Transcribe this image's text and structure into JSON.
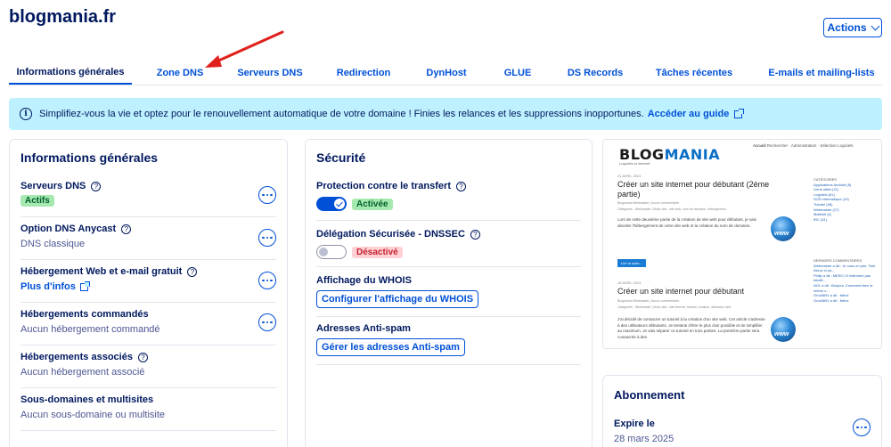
{
  "header": {
    "domain": "blogmania.fr",
    "actions_label": "Actions"
  },
  "tabs": [
    {
      "label": "Informations générales"
    },
    {
      "label": "Zone DNS"
    },
    {
      "label": "Serveurs DNS"
    },
    {
      "label": "Redirection"
    },
    {
      "label": "DynHost"
    },
    {
      "label": "GLUE"
    },
    {
      "label": "DS Records"
    },
    {
      "label": "Tâches récentes"
    },
    {
      "label": "E-mails et mailing-lists"
    }
  ],
  "banner": {
    "text": "Simplifiez-vous la vie et optez pour le renouvellement automatique de votre domaine ! Finies les relances et les suppressions inopportunes.",
    "link": "Accéder au guide"
  },
  "general_info": {
    "title": "Informations générales",
    "items": [
      {
        "label": "Serveurs DNS",
        "value": "Actifs"
      },
      {
        "label": "Option DNS Anycast",
        "value": "DNS classique"
      },
      {
        "label": "Hébergement Web et e-mail gratuit",
        "value": "Plus d'infos"
      },
      {
        "label": "Hébergements commandés",
        "value": "Aucun hébergement commandé"
      },
      {
        "label": "Hébergements associés",
        "value": "Aucun hébergement associé"
      },
      {
        "label": "Sous-domaines et multisites",
        "value": "Aucun sous-domaine ou multisite"
      }
    ]
  },
  "security": {
    "title": "Sécurité",
    "transfer_label": "Protection contre le transfert",
    "transfer_status": "Activée",
    "dnssec_label": "Délégation Sécurisée - DNSSEC",
    "dnssec_status": "Désactivé",
    "whois_label": "Affichage du WHOIS",
    "whois_button": "Configurer l'affichage du WHOIS",
    "antispam_label": "Adresses Anti-spam",
    "antispam_button": "Gérer les adresses Anti-spam"
  },
  "preview": {
    "logo_a": "BLOG",
    "logo_b": "MANIA",
    "tagline": "Logiciels et internet",
    "nav": [
      "Accueil",
      "Rechercher",
      "Administration",
      "Sélection",
      "Logiciels"
    ],
    "post1": {
      "date": "21 AVRIL 2024",
      "title": "Créer un site internet pour débutant (2ème partie)",
      "meta": "Blogmania Webmaster | Aucun commentaire",
      "cats": "Catégories : Webmaster | Mots clés : site web, nom de domaine, hébergement",
      "text": "Lors de cette deuxième partie de la création de site web pour débutant, je vais aborder l'hébergement de votre site web et la création du nom de domaine.",
      "btn": "Lire la suite..."
    },
    "post2": {
      "date": "18 AVRIL 2024",
      "title": "Créer un site internet pour débutant",
      "meta": "Blogmania Webmaster | Aucun commentaire",
      "cats": "Catégories : Webmaster | Mots clés : site internet, tutoriel, création, débutant, html",
      "text": "J'ai décidé de consacrer un tutoriel à la création d'un site web. Cet article s'adresse à des utilisateurs débutants. Je tenterai d'être le plus clair possible et de simplifier au maximum. Je vais séparer ce tutoriel en trois parties. La première partie sera consacrée à des"
    },
    "sidebar_categories_title": "CATÉGORIES",
    "sidebar_categories": [
      "Applications Android (5)",
      "Liens utiles (21)",
      "Logiciels (61)",
      "SOS informatique (19)",
      "Tutoriel (36)",
      "Webmaster (17)",
      "Matériel (1)",
      "IRC (41)"
    ],
    "sidebar_comments_title": "DERNIERS COMMENTAIRES",
    "sidebar_comments": [
      "Webmaster a dit : Je vous en prie. Tant mieux si ça...",
      "Philip a dit : MERCI !!! tellement pas intuitif...",
      "NGL a dit : Bonjour, Comment faire la même c...",
      "Orca3691 a dit : Merci",
      "Orca3691 a dit : Merci"
    ]
  },
  "subscription": {
    "title": "Abonnement",
    "expires_label": "Expire le",
    "expires_date": "28 mars 2025"
  }
}
